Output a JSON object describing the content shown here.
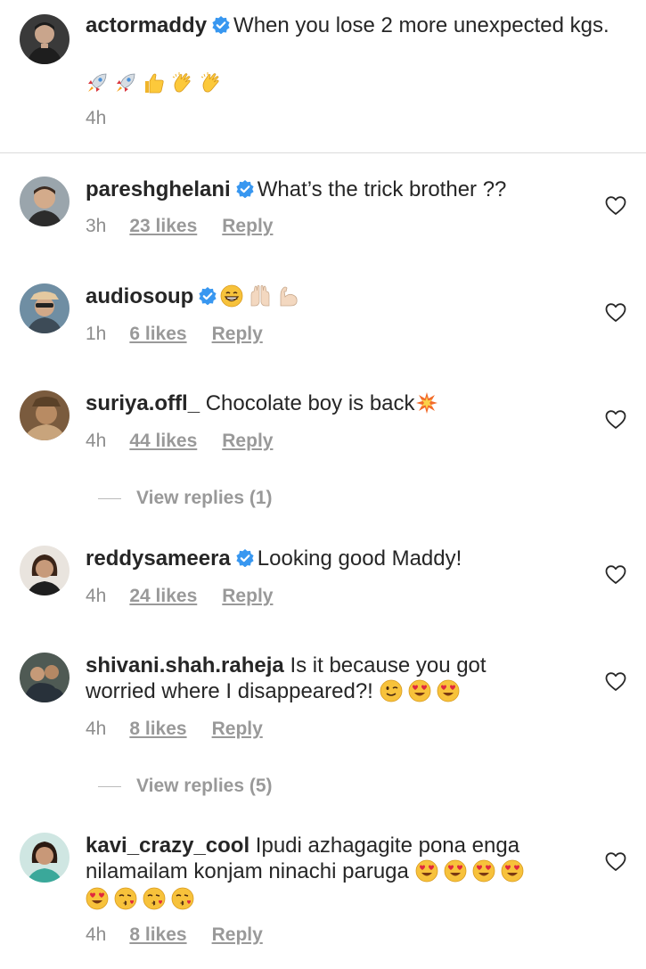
{
  "caption": {
    "username": "actormaddy",
    "text": "When you lose 2 more unexpected kgs.",
    "emojis": [
      "rocket",
      "rocket",
      "thumbs-up",
      "clapping-hands",
      "clapping-hands"
    ],
    "time": "4h"
  },
  "comments": [
    {
      "username": "pareshghelani",
      "verified": true,
      "text": "What’s the trick brother ??",
      "time": "3h",
      "likes": "23 likes",
      "reply": "Reply"
    },
    {
      "username": "audiosoup",
      "verified": true,
      "text": "",
      "emojis": [
        "grinning-face",
        "raising-hands",
        "flexed-biceps"
      ],
      "time": "1h",
      "likes": "6 likes",
      "reply": "Reply"
    },
    {
      "username": "suriya.offl_",
      "verified": false,
      "text": "Chocolate boy is back",
      "emojis": [
        "collision"
      ],
      "time": "4h",
      "likes": "44 likes",
      "reply": "Reply",
      "view_replies": "View replies (1)"
    },
    {
      "username": "reddysameera",
      "verified": true,
      "text": "Looking good Maddy!",
      "time": "4h",
      "likes": "24 likes",
      "reply": "Reply"
    },
    {
      "username": "shivani.shah.raheja",
      "verified": false,
      "text": "Is it because you got worried where I disappeared?!",
      "emojis": [
        "winking-face",
        "heart-eyes",
        "heart-eyes"
      ],
      "time": "4h",
      "likes": "8 likes",
      "reply": "Reply",
      "view_replies": "View replies (5)"
    },
    {
      "username": "kavi_crazy_cool",
      "verified": false,
      "text": "Ipudi azhagagite pona enga nilamailam konjam ninachi paruga",
      "emojis": [
        "heart-eyes",
        "heart-eyes",
        "heart-eyes",
        "heart-eyes",
        "heart-eyes",
        "kissing-face",
        "kissing-face",
        "kissing-face"
      ],
      "time": "4h",
      "likes": "8 likes",
      "reply": "Reply"
    }
  ],
  "colors": {
    "text": "#262626",
    "meta": "#8e8e8e",
    "verified": "#3897f0",
    "divider": "#dbdbdb"
  }
}
